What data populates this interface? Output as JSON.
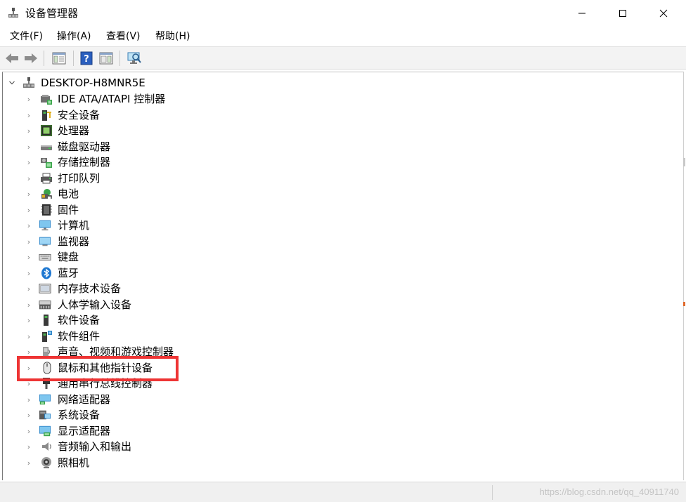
{
  "window": {
    "title": "设备管理器",
    "icon": "device-manager-icon"
  },
  "menu": [
    {
      "label": "文件(F)"
    },
    {
      "label": "操作(A)"
    },
    {
      "label": "查看(V)"
    },
    {
      "label": "帮助(H)"
    }
  ],
  "toolbar": {
    "buttons": [
      "back-arrow-icon",
      "forward-arrow-icon",
      "properties-icon",
      "help-icon",
      "update-driver-icon",
      "scan-hardware-icon"
    ]
  },
  "tree": {
    "root": {
      "label": "DESKTOP-H8MNR5E",
      "expanded": true,
      "icon": "computer-root-icon"
    },
    "children": [
      {
        "label": "IDE ATA/ATAPI 控制器",
        "icon": "ide-controller-icon"
      },
      {
        "label": "安全设备",
        "icon": "security-device-icon"
      },
      {
        "label": "处理器",
        "icon": "processor-icon"
      },
      {
        "label": "磁盘驱动器",
        "icon": "disk-drive-icon"
      },
      {
        "label": "存储控制器",
        "icon": "storage-controller-icon"
      },
      {
        "label": "打印队列",
        "icon": "printer-icon"
      },
      {
        "label": "电池",
        "icon": "battery-icon"
      },
      {
        "label": "固件",
        "icon": "firmware-icon"
      },
      {
        "label": "计算机",
        "icon": "computer-icon"
      },
      {
        "label": "监视器",
        "icon": "monitor-icon"
      },
      {
        "label": "键盘",
        "icon": "keyboard-icon"
      },
      {
        "label": "蓝牙",
        "icon": "bluetooth-icon"
      },
      {
        "label": "内存技术设备",
        "icon": "memory-device-icon"
      },
      {
        "label": "人体学输入设备",
        "icon": "hid-icon"
      },
      {
        "label": "软件设备",
        "icon": "software-device-icon"
      },
      {
        "label": "软件组件",
        "icon": "software-component-icon"
      },
      {
        "label": "声音、视频和游戏控制器",
        "icon": "sound-controller-icon"
      },
      {
        "label": "鼠标和其他指针设备",
        "icon": "mouse-icon",
        "highlighted": true
      },
      {
        "label": "通用串行总线控制器",
        "icon": "usb-icon"
      },
      {
        "label": "网络适配器",
        "icon": "network-adapter-icon"
      },
      {
        "label": "系统设备",
        "icon": "system-device-icon"
      },
      {
        "label": "显示适配器",
        "icon": "display-adapter-icon"
      },
      {
        "label": "音频输入和输出",
        "icon": "audio-io-icon"
      },
      {
        "label": "照相机",
        "icon": "camera-icon"
      }
    ]
  },
  "highlight_color": "#ee3434",
  "status": {
    "watermark": "https://blog.csdn.net/qq_40911740"
  }
}
